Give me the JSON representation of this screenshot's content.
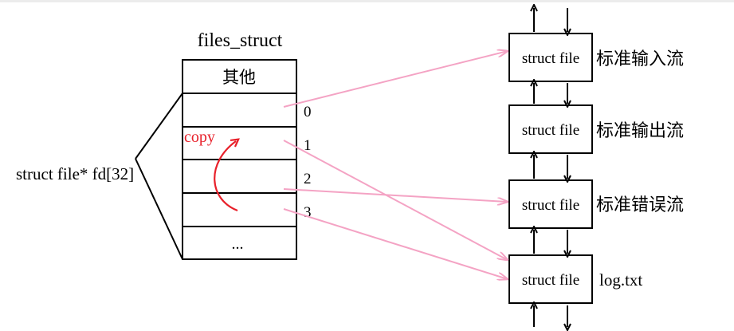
{
  "files_struct": {
    "title": "files_struct",
    "header_cell": "其他",
    "fd_label": "struct file* fd[32]",
    "indices": [
      "0",
      "1",
      "2",
      "3"
    ],
    "last_cell": "...",
    "copy_label": "copy"
  },
  "files": [
    {
      "box_label": "struct file",
      "side_label": "标准输入流"
    },
    {
      "box_label": "struct file",
      "side_label": "标准输出流"
    },
    {
      "box_label": "struct file",
      "side_label": "标准错误流"
    },
    {
      "box_label": "struct file",
      "side_label": "log.txt"
    }
  ],
  "colors": {
    "line": "#000000",
    "pointer_arrow": "#f4a3c4",
    "copy_text": "#e8202a",
    "copy_arrow": "#e8202a"
  }
}
